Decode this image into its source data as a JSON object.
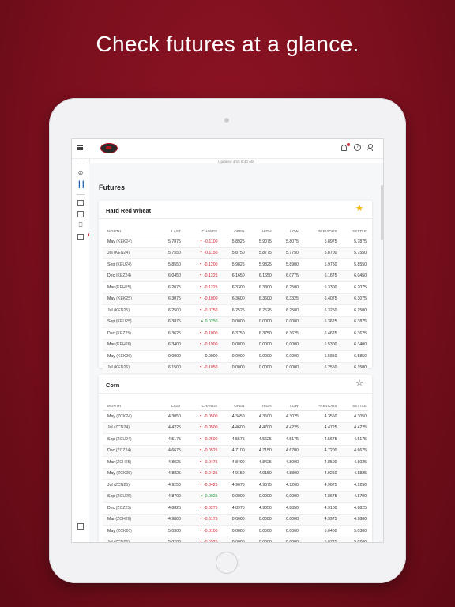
{
  "headline": "Check futures at a glance.",
  "app": {
    "updated_text": "Updated 4/15 9:40 AM",
    "page_title": "Futures"
  },
  "columns": [
    "MONTH",
    "LAST",
    "CHANGE",
    "OPEN",
    "HIGH",
    "LOW",
    "PREVIOUS",
    "SETTLE"
  ],
  "cards": [
    {
      "title": "Hard Red Wheat",
      "favorite": true,
      "rows": [
        {
          "month": "May",
          "sym": "(KEK24)",
          "last": "5.7875",
          "change": "-0.1100",
          "dir": "neg",
          "open": "5.8925",
          "high": "5.9075",
          "low": "5.8075",
          "previous": "5.8975",
          "settle": "5.7875"
        },
        {
          "month": "Jul",
          "sym": "(KEN24)",
          "last": "5.7550",
          "change": "-0.1150",
          "dir": "neg",
          "open": "5.8750",
          "high": "5.8775",
          "low": "5.7750",
          "previous": "5.8700",
          "settle": "5.7550"
        },
        {
          "month": "Sep",
          "sym": "(KEU24)",
          "last": "5.8550",
          "change": "-0.1200",
          "dir": "neg",
          "open": "5.9825",
          "high": "5.9825",
          "low": "5.8900",
          "previous": "5.9750",
          "settle": "5.8550"
        },
        {
          "month": "Dec",
          "sym": "(KEZ24)",
          "last": "6.0450",
          "change": "-0.1225",
          "dir": "neg",
          "open": "6.1650",
          "high": "6.1650",
          "low": "6.0775",
          "previous": "6.1675",
          "settle": "6.0450"
        },
        {
          "month": "Mar",
          "sym": "(KEH25)",
          "last": "6.2075",
          "change": "-0.1225",
          "dir": "neg",
          "open": "6.3300",
          "high": "6.3300",
          "low": "6.2500",
          "previous": "6.3300",
          "settle": "6.2075"
        },
        {
          "month": "May",
          "sym": "(KEK25)",
          "last": "6.3075",
          "change": "-0.1000",
          "dir": "neg",
          "open": "6.3600",
          "high": "6.3600",
          "low": "6.3325",
          "previous": "6.4075",
          "settle": "6.3075"
        },
        {
          "month": "Jul",
          "sym": "(KEN25)",
          "last": "6.2500",
          "change": "-0.0750",
          "dir": "neg",
          "open": "6.2525",
          "high": "6.2525",
          "low": "6.2500",
          "previous": "6.3250",
          "settle": "6.2500"
        },
        {
          "month": "Sep",
          "sym": "(KEU25)",
          "last": "6.3875",
          "change": "0.0250",
          "dir": "pos",
          "open": "0.0000",
          "high": "0.0000",
          "low": "0.0000",
          "previous": "6.3625",
          "settle": "6.3875"
        },
        {
          "month": "Dec",
          "sym": "(KEZ25)",
          "last": "6.3625",
          "change": "-0.1000",
          "dir": "neg",
          "open": "6.3750",
          "high": "6.3750",
          "low": "6.3625",
          "previous": "6.4625",
          "settle": "6.3625"
        },
        {
          "month": "Mar",
          "sym": "(KEH26)",
          "last": "6.3400",
          "change": "-0.1900",
          "dir": "neg",
          "open": "0.0000",
          "high": "0.0000",
          "low": "0.0000",
          "previous": "6.5300",
          "settle": "6.3400"
        },
        {
          "month": "May",
          "sym": "(KEK26)",
          "last": "0.0000",
          "change": "0.0000",
          "dir": "none",
          "open": "0.0000",
          "high": "0.0000",
          "low": "0.0000",
          "previous": "6.5850",
          "settle": "6.5850"
        },
        {
          "month": "Jul",
          "sym": "(KEN26)",
          "last": "6.1500",
          "change": "-0.1050",
          "dir": "neg",
          "open": "0.0000",
          "high": "0.0000",
          "low": "0.0000",
          "previous": "6.2550",
          "settle": "6.1500"
        }
      ]
    },
    {
      "title": "Corn",
      "favorite": false,
      "rows": [
        {
          "month": "May",
          "sym": "(ZCK24)",
          "last": "4.3050",
          "change": "-0.0500",
          "dir": "neg",
          "open": "4.3450",
          "high": "4.3500",
          "low": "4.3025",
          "previous": "4.3550",
          "settle": "4.3050"
        },
        {
          "month": "Jul",
          "sym": "(ZCN24)",
          "last": "4.4225",
          "change": "-0.0500",
          "dir": "neg",
          "open": "4.4600",
          "high": "4.4700",
          "low": "4.4225",
          "previous": "4.4725",
          "settle": "4.4225"
        },
        {
          "month": "Sep",
          "sym": "(ZCU24)",
          "last": "4.5175",
          "change": "-0.0500",
          "dir": "neg",
          "open": "4.5575",
          "high": "4.5625",
          "low": "4.5175",
          "previous": "4.5675",
          "settle": "4.5175"
        },
        {
          "month": "Dec",
          "sym": "(ZCZ24)",
          "last": "4.6675",
          "change": "-0.0525",
          "dir": "neg",
          "open": "4.7100",
          "high": "4.7150",
          "low": "4.6700",
          "previous": "4.7200",
          "settle": "4.6675"
        },
        {
          "month": "Mar",
          "sym": "(ZCH25)",
          "last": "4.8025",
          "change": "-0.0475",
          "dir": "neg",
          "open": "4.8400",
          "high": "4.8425",
          "low": "4.8000",
          "previous": "4.8500",
          "settle": "4.8025"
        },
        {
          "month": "May",
          "sym": "(ZCK25)",
          "last": "4.8825",
          "change": "-0.0425",
          "dir": "neg",
          "open": "4.9150",
          "high": "4.9150",
          "low": "4.8800",
          "previous": "4.9250",
          "settle": "4.8825"
        },
        {
          "month": "Jul",
          "sym": "(ZCN25)",
          "last": "4.9250",
          "change": "-0.0425",
          "dir": "neg",
          "open": "4.9675",
          "high": "4.9675",
          "low": "4.9200",
          "previous": "4.9675",
          "settle": "4.9250"
        },
        {
          "month": "Sep",
          "sym": "(ZCU25)",
          "last": "4.8700",
          "change": "0.0025",
          "dir": "pos",
          "open": "0.0000",
          "high": "0.0000",
          "low": "0.0000",
          "previous": "4.8675",
          "settle": "4.8700"
        },
        {
          "month": "Dec",
          "sym": "(ZCZ25)",
          "last": "4.8825",
          "change": "-0.0275",
          "dir": "neg",
          "open": "4.8975",
          "high": "4.9050",
          "low": "4.8850",
          "previous": "4.9100",
          "settle": "4.8825"
        },
        {
          "month": "Mar",
          "sym": "(ZCH26)",
          "last": "4.9800",
          "change": "-0.0175",
          "dir": "neg",
          "open": "0.0000",
          "high": "0.0000",
          "low": "0.0000",
          "previous": "4.9975",
          "settle": "4.9800"
        },
        {
          "month": "May",
          "sym": "(ZCK26)",
          "last": "5.0300",
          "change": "-0.0100",
          "dir": "neg",
          "open": "0.0000",
          "high": "0.0000",
          "low": "0.0000",
          "previous": "5.0400",
          "settle": "5.0300"
        },
        {
          "month": "Jul",
          "sym": "(ZCN26)",
          "last": "5.0200",
          "change": "-0.0525",
          "dir": "neg",
          "open": "0.0000",
          "high": "0.0000",
          "low": "0.0000",
          "previous": "5.0725",
          "settle": "5.0200"
        }
      ]
    }
  ],
  "colors": {
    "background": "#7a0f1d",
    "negative": "#d0202f",
    "positive": "#1f9a3a",
    "favorite_star": "#f0b400"
  },
  "icons": [
    "menu-icon",
    "notification-bell-icon",
    "help-icon",
    "user-account-icon",
    "star-icon"
  ]
}
